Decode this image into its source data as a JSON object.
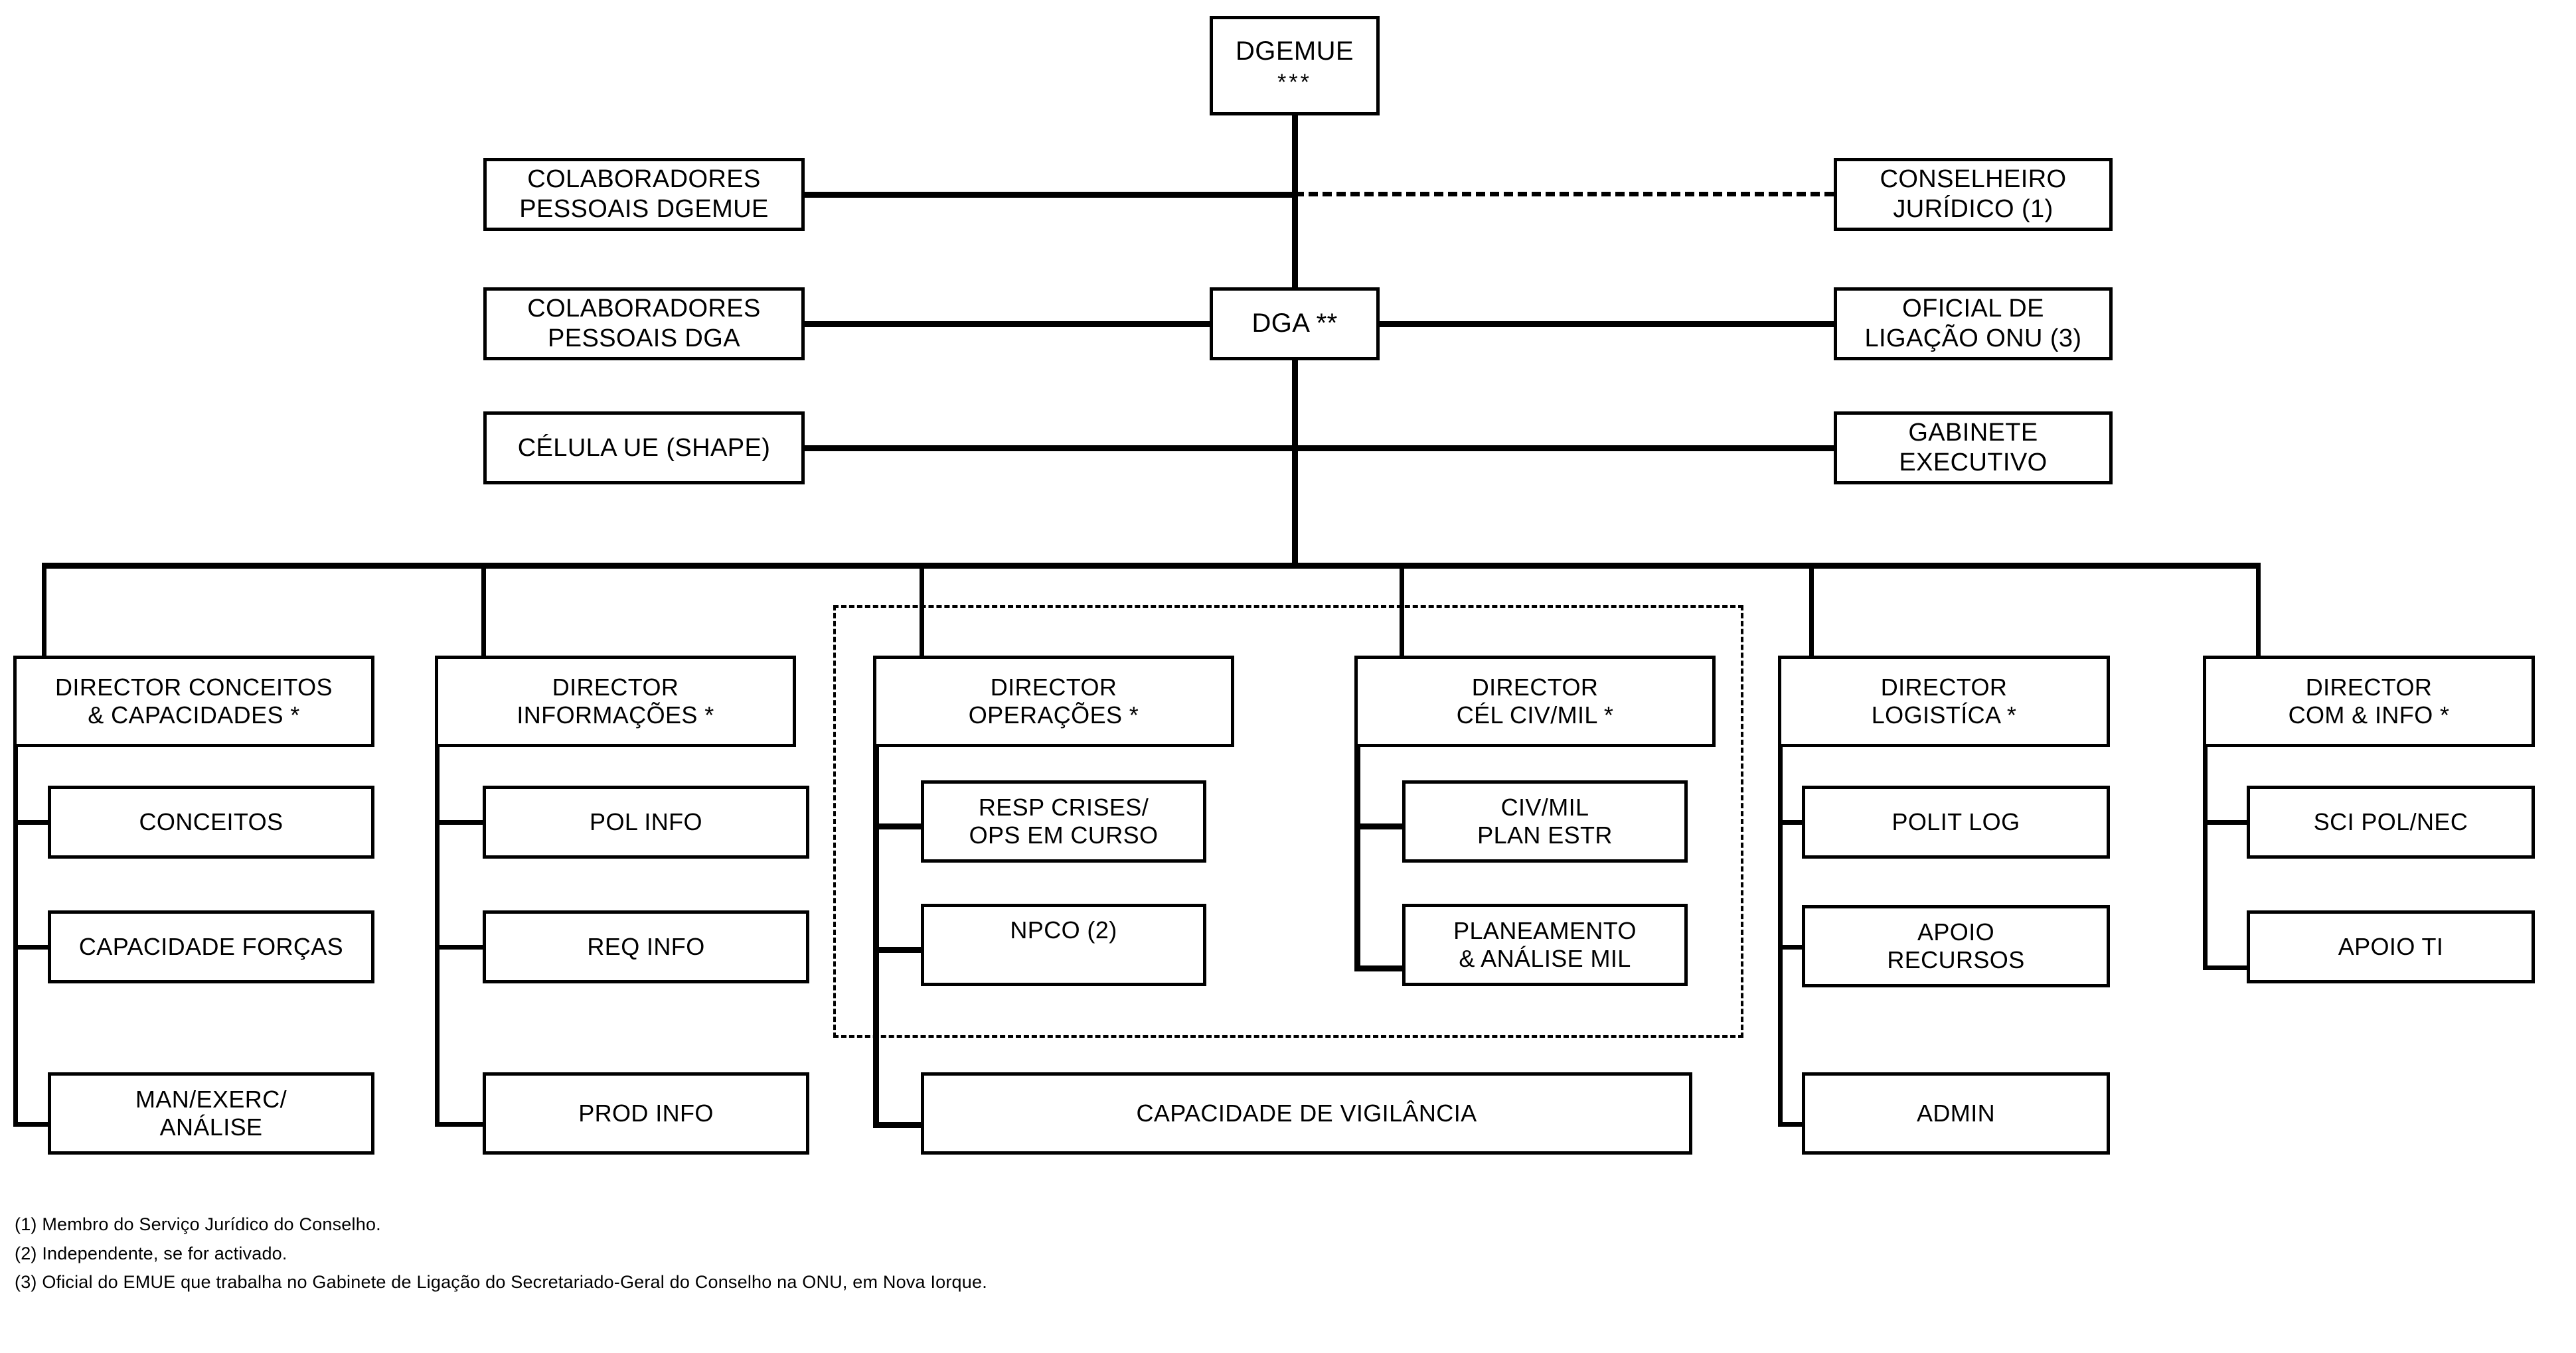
{
  "diagram": {
    "title_box": {
      "label": "DGEMUE",
      "stars": "***"
    },
    "deputy_box": {
      "label": "DGA **"
    },
    "left_column": [
      {
        "line1": "COLABORADORES",
        "line2": "PESSOAIS DGEMUE"
      },
      {
        "line1": "COLABORADORES",
        "line2": "PESSOAIS DGA"
      },
      {
        "line1": "CÉLULA UE (SHAPE)",
        "line2": ""
      }
    ],
    "right_column": [
      {
        "line1": "CONSELHEIRO",
        "line2": "JURÍDICO (1)"
      },
      {
        "line1": "OFICIAL DE",
        "line2": "LIGAÇÃO ONU (3)"
      },
      {
        "line1": "GABINETE",
        "line2": "EXECUTIVO"
      }
    ],
    "directorates": [
      {
        "id": "conceitos-capacidades",
        "head": {
          "line1": "DIRECTOR CONCEITOS",
          "line2": "& CAPACIDADES *"
        },
        "units": [
          {
            "line1": "CONCEITOS",
            "line2": ""
          },
          {
            "line1": "CAPACIDADE FORÇAS",
            "line2": ""
          },
          {
            "line1": "MAN/EXERC/",
            "line2": "ANÁLISE"
          }
        ]
      },
      {
        "id": "informacoes",
        "head": {
          "line1": "DIRECTOR",
          "line2": "INFORMAÇÕES *"
        },
        "units": [
          {
            "line1": "POL INFO",
            "line2": ""
          },
          {
            "line1": "REQ INFO",
            "line2": ""
          },
          {
            "line1": "PROD INFO",
            "line2": ""
          }
        ]
      },
      {
        "id": "operacoes",
        "head": {
          "line1": "DIRECTOR",
          "line2": "OPERAÇÕES *"
        },
        "units": [
          {
            "line1": "RESP CRISES/",
            "line2": "OPS EM CURSO"
          },
          {
            "line1": "NPCO (2)",
            "line2": ""
          }
        ]
      },
      {
        "id": "cel-civ-mil",
        "head": {
          "line1": "DIRECTOR",
          "line2": "CÉL CIV/MIL *"
        },
        "units": [
          {
            "line1": "CIV/MIL",
            "line2": "PLAN ESTR"
          },
          {
            "line1": "PLANEAMENTO",
            "line2": "& ANÁLISE MIL"
          }
        ]
      },
      {
        "id": "logistica",
        "head": {
          "line1": "DIRECTOR",
          "line2": "LOGISTÍCA *"
        },
        "units": [
          {
            "line1": "POLIT LOG",
            "line2": ""
          },
          {
            "line1": "APOIO",
            "line2": "RECURSOS"
          },
          {
            "line1": "ADMIN",
            "line2": ""
          }
        ]
      },
      {
        "id": "com-info",
        "head": {
          "line1": "DIRECTOR",
          "line2": "COM &  INFO *"
        },
        "units": [
          {
            "line1": "SCI POL/NEC",
            "line2": ""
          },
          {
            "line1": "APOIO TI",
            "line2": ""
          }
        ]
      }
    ],
    "wide_unit": {
      "label": "CAPACIDADE DE VIGILÂNCIA"
    },
    "footnotes": [
      {
        "marker": "(1)",
        "text": "Membro do Serviço Jurídico do Conselho."
      },
      {
        "marker": "(2)",
        "text": "Independente, se for activado."
      },
      {
        "marker": "(3)",
        "text": "Oficial do EMUE que trabalha no Gabinete de Ligação do Secretariado-Geral do Conselho na ONU, em Nova Iorque."
      }
    ]
  },
  "colors": {
    "line": "#000000",
    "background": "#ffffff"
  }
}
